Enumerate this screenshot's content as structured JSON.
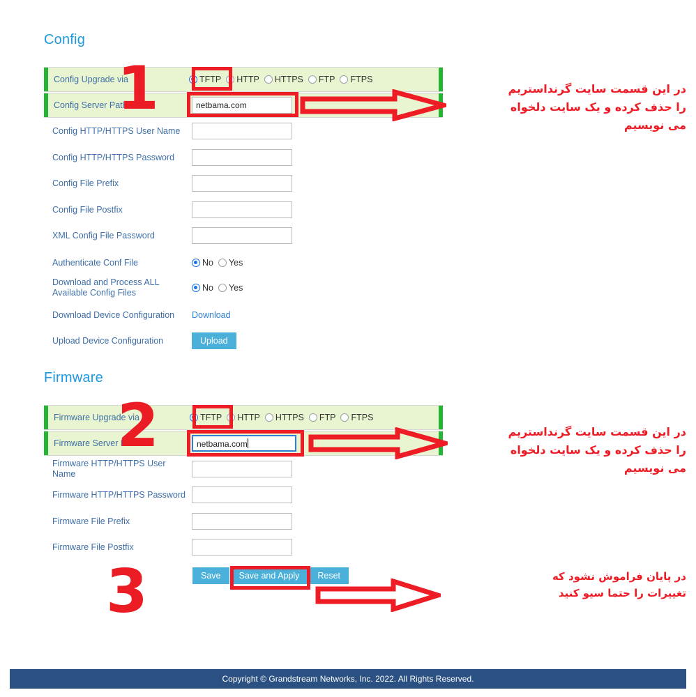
{
  "sections": {
    "config": {
      "title": "Config",
      "rows": [
        {
          "label": "Config Upgrade via",
          "type": "radio-protocol"
        },
        {
          "label": "Config Server Path",
          "type": "text",
          "value": "netbama.com"
        },
        {
          "label": "Config HTTP/HTTPS User Name",
          "type": "text",
          "value": ""
        },
        {
          "label": "Config HTTP/HTTPS Password",
          "type": "text",
          "value": ""
        },
        {
          "label": "Config File Prefix",
          "type": "text",
          "value": ""
        },
        {
          "label": "Config File Postfix",
          "type": "text",
          "value": ""
        },
        {
          "label": "XML Config File Password",
          "type": "text",
          "value": ""
        },
        {
          "label": "Authenticate Conf File",
          "type": "radio-yesno"
        },
        {
          "label": "Download and Process ALL Available Config Files",
          "type": "radio-yesno"
        },
        {
          "label": "Download Device Configuration",
          "type": "link",
          "value": "Download"
        },
        {
          "label": "Upload Device Configuration",
          "type": "button",
          "value": "Upload"
        }
      ]
    },
    "firmware": {
      "title": "Firmware",
      "rows": [
        {
          "label": "Firmware Upgrade via",
          "type": "radio-protocol"
        },
        {
          "label": "Firmware Server Path",
          "type": "text",
          "value": "netbama.com"
        },
        {
          "label": "Firmware HTTP/HTTPS User Name",
          "type": "text",
          "value": ""
        },
        {
          "label": "Firmware HTTP/HTTPS Password",
          "type": "text",
          "value": ""
        },
        {
          "label": "Firmware File Prefix",
          "type": "text",
          "value": ""
        },
        {
          "label": "Firmware File Postfix",
          "type": "text",
          "value": ""
        }
      ]
    }
  },
  "protocol_options": [
    "TFTP",
    "HTTP",
    "HTTPS",
    "FTP",
    "FTPS"
  ],
  "protocol_selected": "TFTP",
  "yesno_options": [
    "No",
    "Yes"
  ],
  "yesno_selected": "No",
  "buttons": {
    "save": "Save",
    "save_and_apply": "Save and Apply",
    "reset": "Reset",
    "upload": "Upload"
  },
  "links": {
    "download": "Download"
  },
  "annotations": {
    "numbers": {
      "one": "1",
      "two": "2",
      "three": "3"
    },
    "text_1": "در این قسمت  سایت گرنداستریم\nرا حذف کرده و یک سایت دلخواه\nمی نویسیم",
    "text_2": "در این قسمت  سایت گرنداستریم\nرا حذف کرده و یک سایت دلخواه\nمی نویسیم",
    "text_3": "در پایان فراموش نشود که\nتغییرات را حتما سیو کنید",
    "color": "#ee1c25"
  },
  "footer": {
    "copyright": "Copyright © Grandstream Networks, Inc. 2022. All Rights Reserved."
  },
  "colors": {
    "heading": "#1f9ae0",
    "label": "#3f6fa8",
    "highlight_row_bg": "#e9f5d0",
    "accent_bar": "#25b535",
    "button": "#4aafd9",
    "footer_bg": "#2a5182",
    "radio_selected": "#1a73e8"
  }
}
